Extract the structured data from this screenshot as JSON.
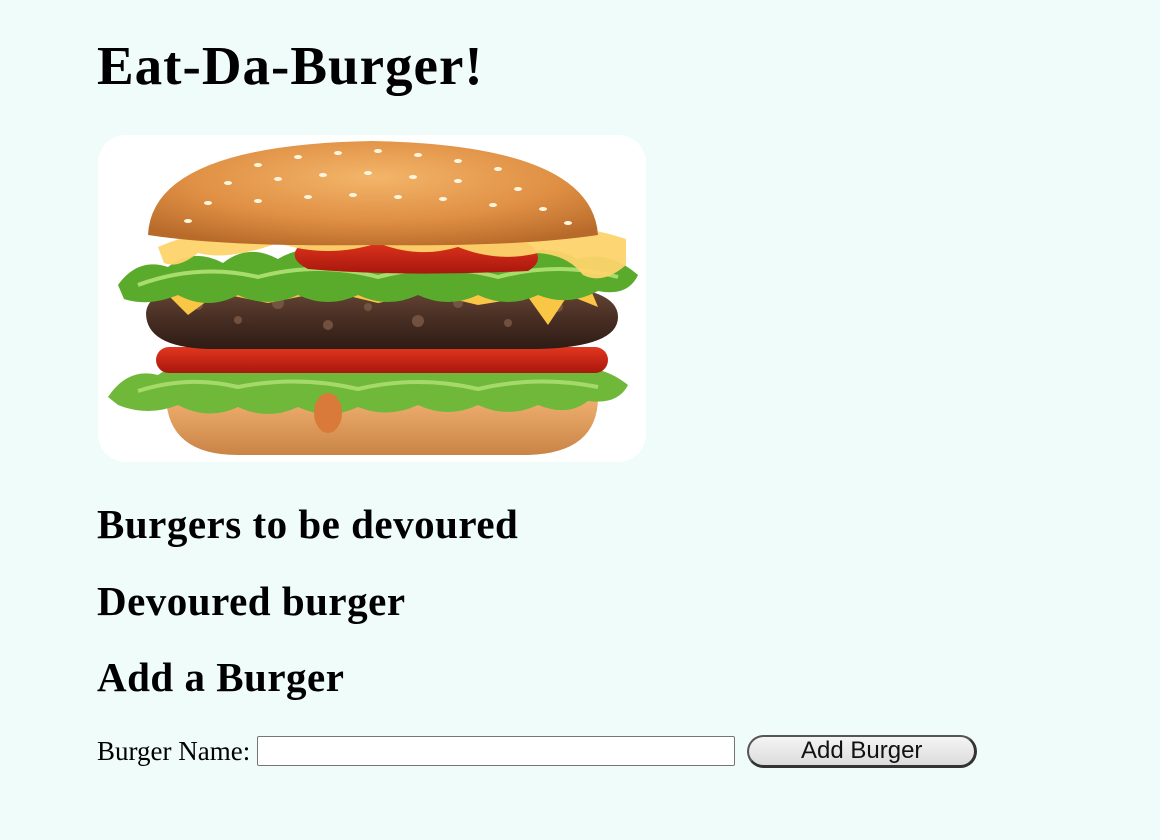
{
  "header": {
    "title": "Eat-Da-Burger!"
  },
  "hero_image": {
    "icon": "burger-image"
  },
  "sections": {
    "to_devour": "Burgers to be devoured",
    "devoured": "Devoured burger",
    "add": "Add a Burger"
  },
  "form": {
    "name_label": "Burger Name:",
    "name_value": "",
    "name_placeholder": "",
    "submit_label": "Add Burger"
  },
  "colors": {
    "page_background": "#effcfa"
  }
}
